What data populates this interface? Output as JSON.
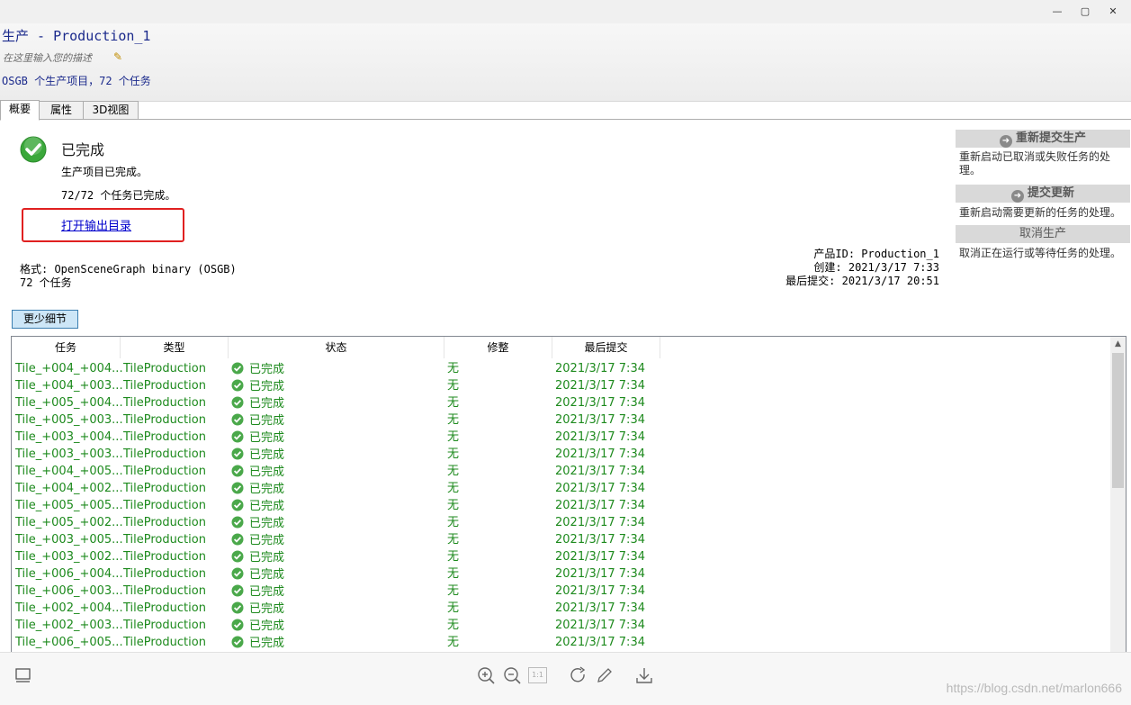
{
  "window": {
    "minimize": "—",
    "maximize": "▢",
    "close": "✕"
  },
  "header": {
    "title": "生产 - Production_1",
    "description_placeholder": "在这里输入您的描述",
    "summary": "OSGB 个生产项目，72 个任务"
  },
  "tabs": [
    "概要",
    "属性",
    "3D视图"
  ],
  "status": {
    "title": "已完成",
    "line1": "生产项目已完成。",
    "line2": "72/72 个任务已完成。",
    "open_output_link": "打开输出目录"
  },
  "info": {
    "format": "格式: OpenSceneGraph binary (OSGB)",
    "tasks": "72 个任务",
    "product_id": "产品ID: Production_1",
    "created": "创建: 2021/3/17 7:33",
    "last_submit": "最后提交: 2021/3/17 20:51"
  },
  "right_panel": {
    "resubmit_label": "重新提交生产",
    "resubmit_desc": "重新启动已取消或失败任务的处理。",
    "update_label": "提交更新",
    "update_desc": "重新启动需要更新的任务的处理。",
    "cancel_label": "取消生产",
    "cancel_desc": "取消正在运行或等待任务的处理。"
  },
  "less_details_button": "更少细节",
  "table": {
    "columns": [
      "任务",
      "类型",
      "状态",
      "修整",
      "最后提交"
    ],
    "rows": [
      [
        "Tile_+004_+004...",
        "TileProduction",
        "已完成",
        "无",
        "2021/3/17 7:34"
      ],
      [
        "Tile_+004_+003...",
        "TileProduction",
        "已完成",
        "无",
        "2021/3/17 7:34"
      ],
      [
        "Tile_+005_+004...",
        "TileProduction",
        "已完成",
        "无",
        "2021/3/17 7:34"
      ],
      [
        "Tile_+005_+003...",
        "TileProduction",
        "已完成",
        "无",
        "2021/3/17 7:34"
      ],
      [
        "Tile_+003_+004...",
        "TileProduction",
        "已完成",
        "无",
        "2021/3/17 7:34"
      ],
      [
        "Tile_+003_+003...",
        "TileProduction",
        "已完成",
        "无",
        "2021/3/17 7:34"
      ],
      [
        "Tile_+004_+005...",
        "TileProduction",
        "已完成",
        "无",
        "2021/3/17 7:34"
      ],
      [
        "Tile_+004_+002...",
        "TileProduction",
        "已完成",
        "无",
        "2021/3/17 7:34"
      ],
      [
        "Tile_+005_+005...",
        "TileProduction",
        "已完成",
        "无",
        "2021/3/17 7:34"
      ],
      [
        "Tile_+005_+002...",
        "TileProduction",
        "已完成",
        "无",
        "2021/3/17 7:34"
      ],
      [
        "Tile_+003_+005...",
        "TileProduction",
        "已完成",
        "无",
        "2021/3/17 7:34"
      ],
      [
        "Tile_+003_+002...",
        "TileProduction",
        "已完成",
        "无",
        "2021/3/17 7:34"
      ],
      [
        "Tile_+006_+004...",
        "TileProduction",
        "已完成",
        "无",
        "2021/3/17 7:34"
      ],
      [
        "Tile_+006_+003...",
        "TileProduction",
        "已完成",
        "无",
        "2021/3/17 7:34"
      ],
      [
        "Tile_+002_+004...",
        "TileProduction",
        "已完成",
        "无",
        "2021/3/17 7:34"
      ],
      [
        "Tile_+002_+003...",
        "TileProduction",
        "已完成",
        "无",
        "2021/3/17 7:34"
      ],
      [
        "Tile_+006_+005...",
        "TileProduction",
        "已完成",
        "无",
        "2021/3/17 7:34"
      ]
    ]
  },
  "bottom_toolbar": {
    "icons": [
      "panel-icon",
      "zoom-in-icon",
      "zoom-out-icon",
      "actual-size-icon",
      "rotate-icon",
      "edit-icon",
      "download-icon"
    ],
    "actual_size_label": "1:1"
  },
  "watermark": "https://blog.csdn.net/marlon666",
  "colors": {
    "done_green": "#1d8a1d",
    "header_blue": "#1b2a8c",
    "highlight_red": "#e02020"
  }
}
